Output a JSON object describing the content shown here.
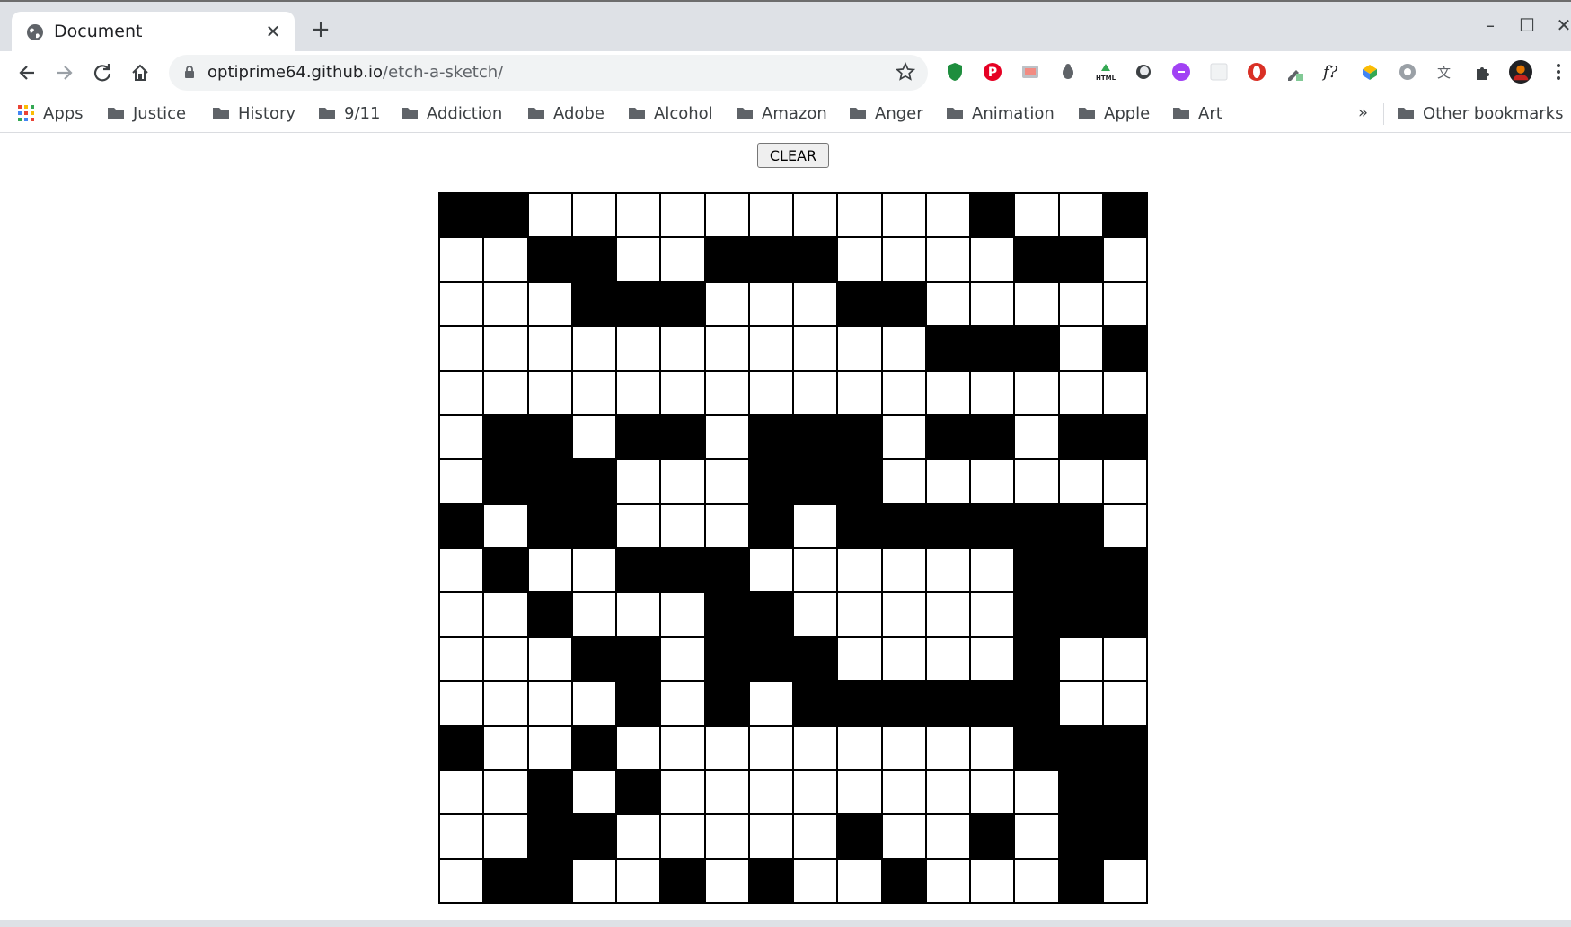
{
  "browser": {
    "tab_title": "Document",
    "tab_close": "✕",
    "new_tab": "+",
    "window_controls": {
      "minimize": "–",
      "maximize": "☐",
      "close": "✕"
    },
    "url_host": "optiprime64.github.io",
    "url_path": "/etch-a-sketch/",
    "bookmarks": [
      "Apps",
      "Justice",
      "History",
      "9/11",
      "Addiction",
      "Adobe",
      "Alcohol",
      "Amazon",
      "Anger",
      "Animation",
      "Apple",
      "Art"
    ],
    "bookmarks_overflow": "»",
    "other_bookmarks": "Other bookmarks",
    "extensions": [
      "shield-icon",
      "pinterest-icon",
      "screenshot-icon",
      "bug-icon",
      "html-icon",
      "circle-icon",
      "purple-code-icon",
      "blank-icon",
      "opera-icon",
      "eyedropper-icon",
      "f-question-icon",
      "color-icon",
      "gear-icon",
      "translate-icon",
      "puzzle-icon",
      "avatar",
      "more-icon"
    ]
  },
  "page": {
    "clear_label": "CLEAR",
    "grid_size": 16,
    "grid": [
      "1100000000001001",
      "0011001110000110",
      "0001110001100000",
      "0000000000011101",
      "0000000000000000",
      "0110110111011011",
      "0111000111000000",
      "1011000101111110",
      "0100111000000111",
      "0010001100000111",
      "0001101110000100",
      "0000101011111100",
      "1001000000000111",
      "0010100000000011",
      "0011000001001011",
      "0110010100100010"
    ]
  }
}
